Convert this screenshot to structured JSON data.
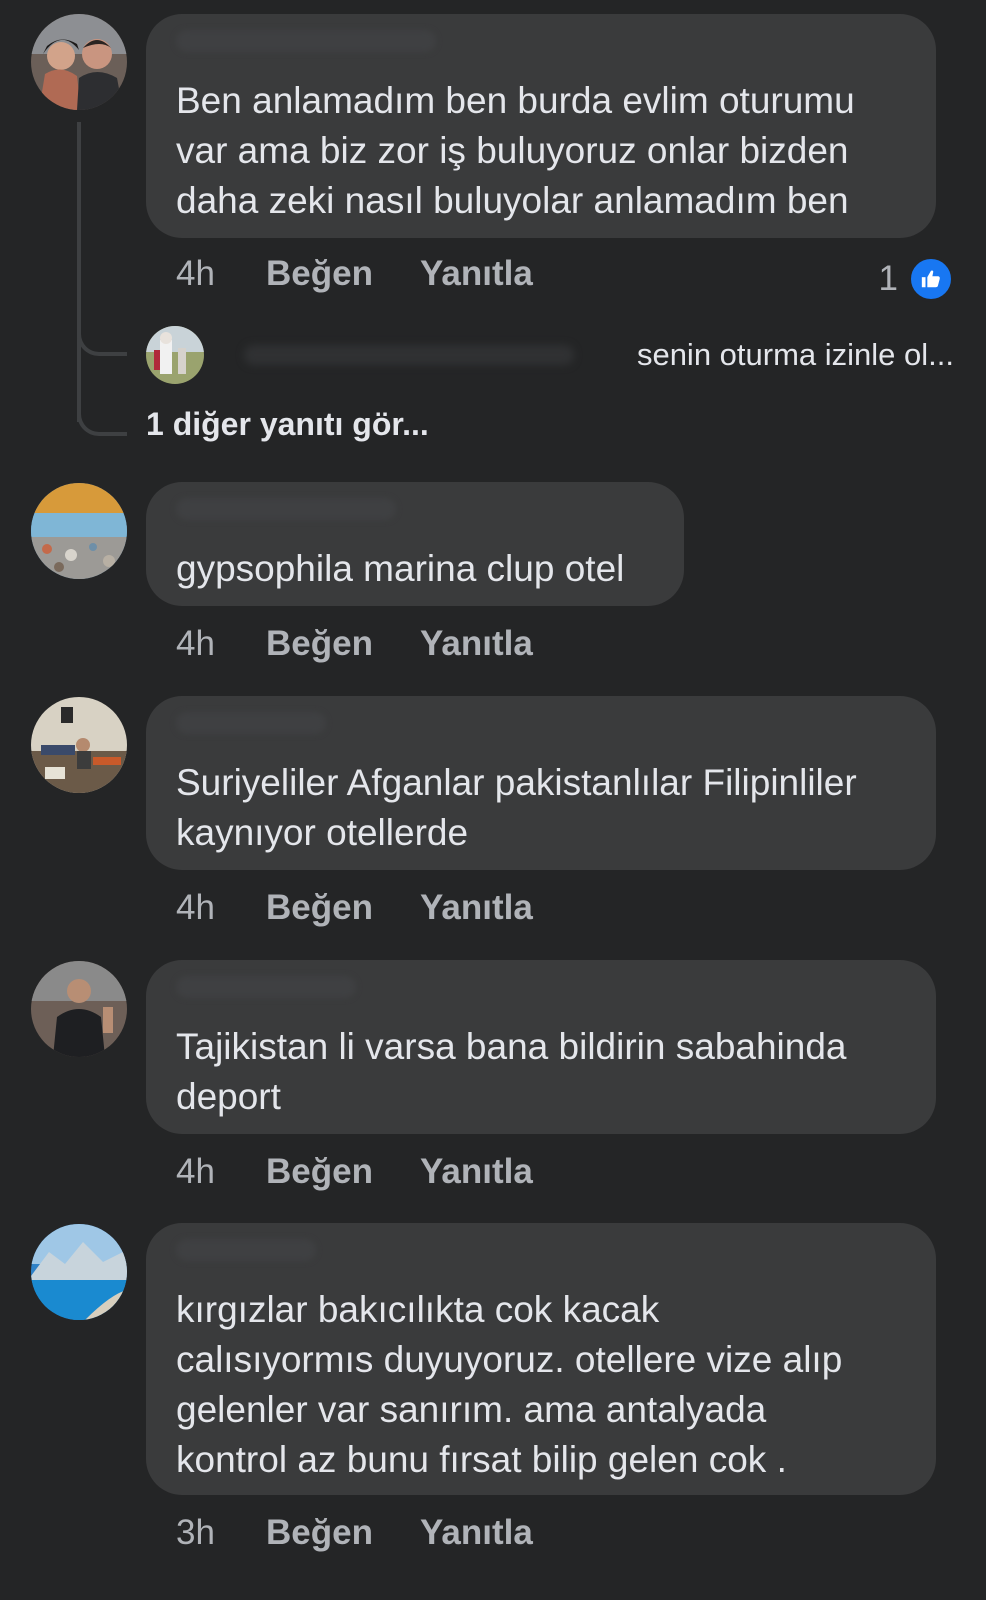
{
  "comments": [
    {
      "text": "Ben anlamadım ben burda evlim oturumu\nvar ama biz zor  iş buluyoruz onlar bizden\ndaha zeki nasıl buluyolar anlamadım ben",
      "time": "4h",
      "like_label": "Beğen",
      "reply_label": "Yanıtla",
      "reaction_count": "1"
    },
    {
      "text": "gypsophila marina clup otel",
      "time": "4h",
      "like_label": "Beğen",
      "reply_label": "Yanıtla"
    },
    {
      "text": "Suriyeliler Afganlar pakistanlılar Filipinliler\nkaynıyor otellerde",
      "time": "4h",
      "like_label": "Beğen",
      "reply_label": "Yanıtla"
    },
    {
      "text": "Tajikistan li varsa bana bildirin sabahinda\ndeport",
      "time": "4h",
      "like_label": "Beğen",
      "reply_label": "Yanıtla"
    },
    {
      "text": "kırgızlar bakıcılıkta  cok kacak\ncalısıyormıs  duyuyoruz. otellere vize alıp\ngelenler var sanırım. ama antalyada\nkontrol az  bunu fırsat bilip   gelen cok .",
      "time": "3h",
      "like_label": "Beğen",
      "reply_label": "Yanıtla"
    }
  ],
  "thread": {
    "reply_preview_text": "senin oturma izinle ol...",
    "more_replies_label": "1 diğer yanıtı gör..."
  },
  "icons": {
    "reaction": "like-thumb-icon"
  },
  "colors": {
    "background": "#242526",
    "bubble": "#3a3b3c",
    "like_blue": "#1877f2",
    "secondary_text": "#b0b3b8"
  }
}
